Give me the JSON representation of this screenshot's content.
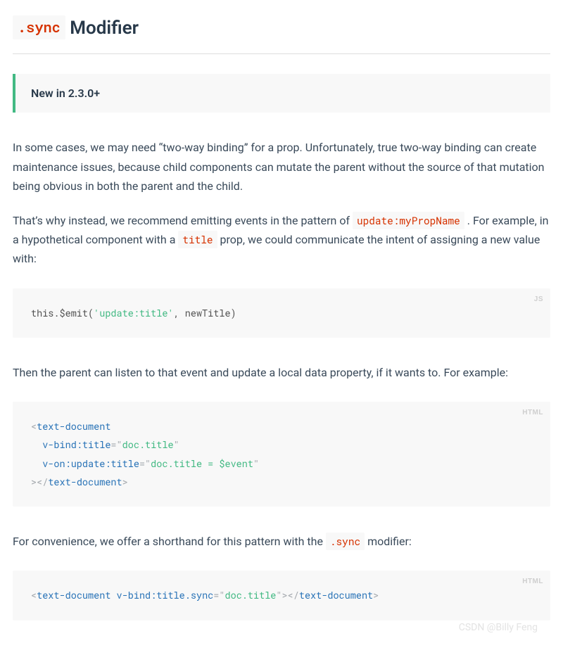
{
  "heading": {
    "code": ".sync",
    "text": " Modifier"
  },
  "callout": {
    "text": "New in 2.3.0+"
  },
  "para1": "In some cases, we may need “two-way binding” for a prop. Unfortunately, true two-way binding can create maintenance issues, because child components can mutate the parent without the source of that mutation being obvious in both the parent and the child.",
  "para2": {
    "a": "That’s why instead, we recommend emitting events in the pattern of ",
    "code1": "update:myPropName",
    "b": " . For example, in a hypothetical component with a ",
    "code2": "title",
    "c": " prop, we could communicate the intent of assigning a new value with:"
  },
  "code1": {
    "lang": "JS",
    "s1": "this.$emit(",
    "str": "'update:title'",
    "s2": ", newTitle)"
  },
  "para3": "Then the parent can listen to that event and update a local data property, if it wants to. For example:",
  "code2": {
    "lang": "HTML",
    "l1p": "<",
    "l1tag": "text-document",
    "l2attr": "v-bind:title",
    "l2eq": "=",
    "l2q": "\"",
    "l2val": "doc.title",
    "l3attr": "v-on:update:title",
    "l3eq": "=",
    "l3q": "\"",
    "l3val": "doc.title = $event",
    "l4a": ">",
    "l4b": "</",
    "l4tag": "text-document",
    "l4c": ">"
  },
  "para4": {
    "a": "For convenience, we offer a shorthand for this pattern with the ",
    "code": ".sync",
    "b": " modifier:"
  },
  "code3": {
    "lang": "HTML",
    "p1": "<",
    "tag1": "text-document",
    "sp": " ",
    "attr": "v-bind:title.sync",
    "eq": "=",
    "q": "\"",
    "val": "doc.title",
    "p2": ">",
    "p3": "</",
    "tag2": "text-document",
    "p4": ">"
  },
  "watermark": "CSDN @Billy Feng"
}
